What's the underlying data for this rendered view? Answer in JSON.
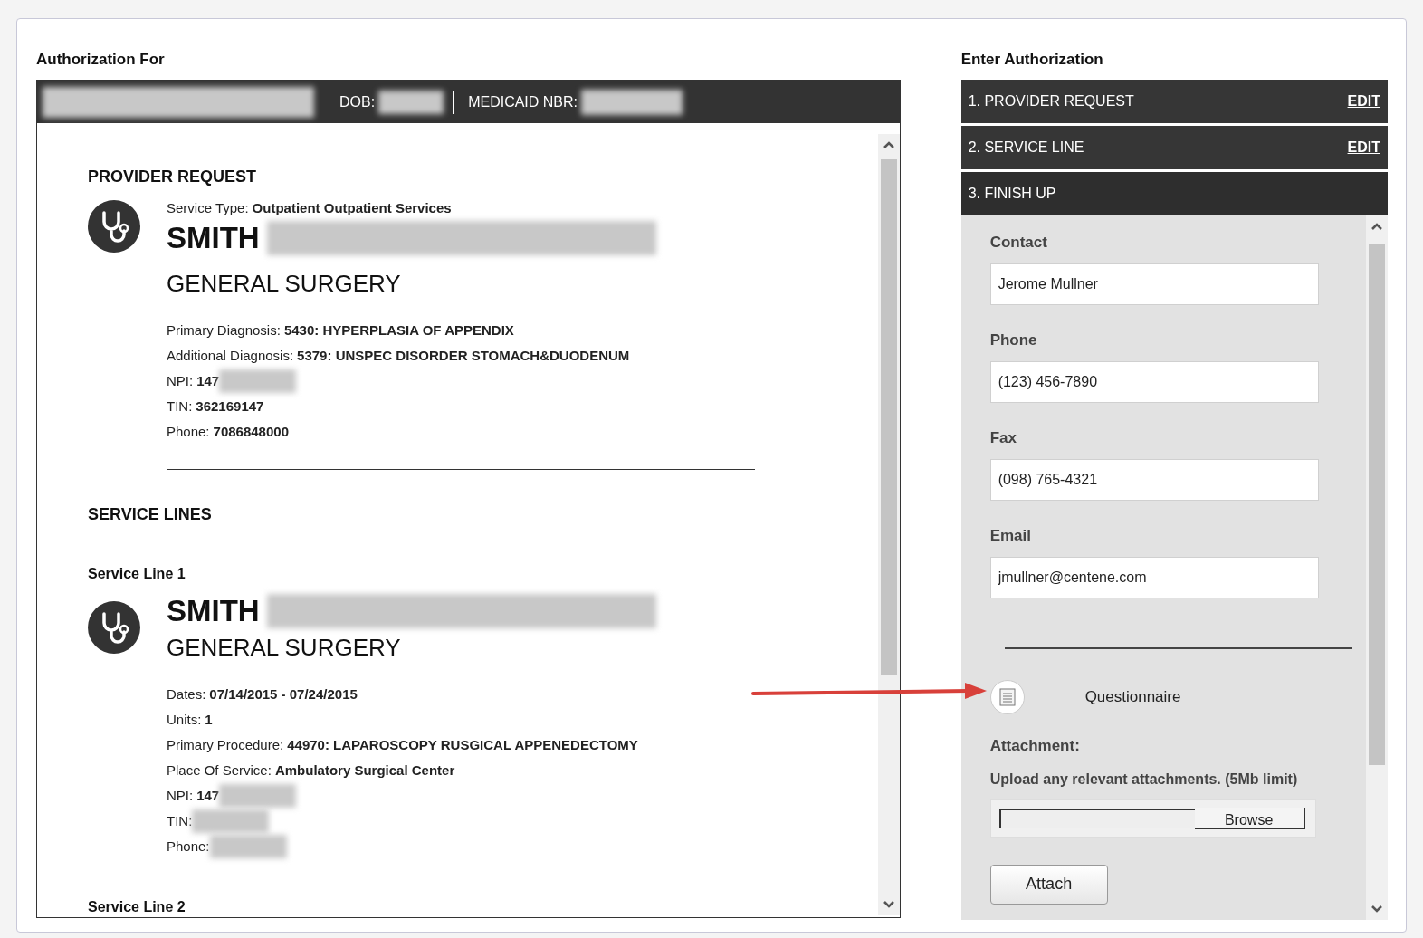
{
  "left": {
    "title": "Authorization For",
    "header": {
      "name_redacted": true,
      "dob_label": "DOB:",
      "medicaid_label": "MEDICAID NBR:"
    },
    "provider_request": {
      "heading": "PROVIDER REQUEST",
      "service_type": {
        "label": "Service Type:",
        "value": "Outpatient Outpatient Services"
      },
      "name": "SMITH",
      "specialty": "GENERAL SURGERY",
      "fields": [
        {
          "label": "Primary Diagnosis:",
          "value": "5430: HYPERPLASIA OF APPENDIX",
          "redacted": false
        },
        {
          "label": "Additional Diagnosis:",
          "value": "5379: UNSPEC DISORDER STOMACH&DUODENUM",
          "redacted": false
        },
        {
          "label": "NPI:",
          "value": "147",
          "redacted": true
        },
        {
          "label": "TIN:",
          "value": "362169147",
          "redacted": false
        },
        {
          "label": "Phone:",
          "value": "7086848000",
          "redacted": false
        }
      ]
    },
    "service_lines": {
      "heading": "SERVICE LINES",
      "items": [
        {
          "title": "Service Line 1",
          "name": "SMITH",
          "specialty": "GENERAL SURGERY",
          "fields": [
            {
              "label": "Dates:",
              "value": "07/14/2015 - 07/24/2015",
              "redacted": false
            },
            {
              "label": "Units:",
              "value": "1",
              "redacted": false
            },
            {
              "label": "Primary Procedure:",
              "value": "44970: LAPAROSCOPY RUSGICAL APPENEDECTOMY",
              "redacted": false
            },
            {
              "label": "Place Of Service:",
              "value": "Ambulatory Surgical Center",
              "redacted": false
            },
            {
              "label": "NPI:",
              "value": "147",
              "redacted": true
            },
            {
              "label": "TIN:",
              "redacted": true
            },
            {
              "label": "Phone:",
              "redacted": true
            }
          ]
        },
        {
          "title": "Service Line 2"
        }
      ]
    }
  },
  "right": {
    "title": "Enter Authorization",
    "steps": [
      {
        "label": "1. PROVIDER REQUEST",
        "action": "EDIT",
        "expanded": false
      },
      {
        "label": "2. SERVICE LINE",
        "action": "EDIT",
        "expanded": false
      },
      {
        "label": "3. FINISH UP",
        "expanded": true
      }
    ],
    "fields": [
      {
        "label": "Contact",
        "value": "Jerome Mullner"
      },
      {
        "label": "Phone",
        "value": "(123) 456-7890"
      },
      {
        "label": "Fax",
        "value": "(098) 765-4321"
      },
      {
        "label": "Email",
        "value": "jmullner@centene.com"
      }
    ],
    "questionnaire": "Questionnaire",
    "attachment_label": "Attachment:",
    "upload_hint": "Upload any relevant attachments. (5Mb limit)",
    "browse": "Browse",
    "attach": "Attach"
  }
}
